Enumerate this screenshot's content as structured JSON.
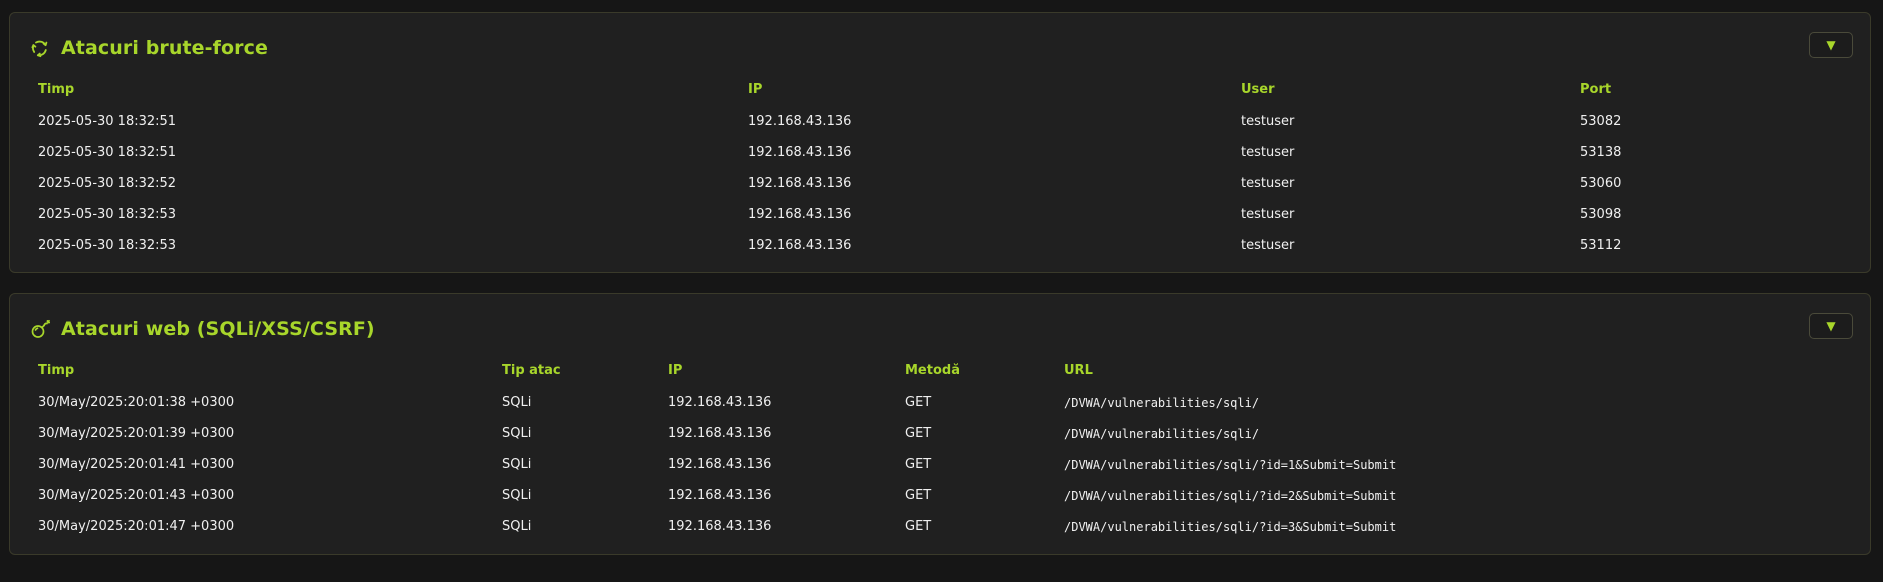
{
  "brute_force": {
    "icon": "recycle-icon",
    "title": "Atacuri brute-force",
    "toggle": "▼",
    "headers": [
      "Timp",
      "IP",
      "User",
      "Port"
    ],
    "rows": [
      [
        "2025-05-30 18:32:51",
        "192.168.43.136",
        "testuser",
        "53082"
      ],
      [
        "2025-05-30 18:32:51",
        "192.168.43.136",
        "testuser",
        "53138"
      ],
      [
        "2025-05-30 18:32:52",
        "192.168.43.136",
        "testuser",
        "53060"
      ],
      [
        "2025-05-30 18:32:53",
        "192.168.43.136",
        "testuser",
        "53098"
      ],
      [
        "2025-05-30 18:32:53",
        "192.168.43.136",
        "testuser",
        "53112"
      ]
    ]
  },
  "web": {
    "icon": "bomb-icon",
    "title": "Atacuri web (SQLi/XSS/CSRF)",
    "toggle": "▼",
    "headers": [
      "Timp",
      "Tip atac",
      "IP",
      "Metodă",
      "URL"
    ],
    "rows": [
      [
        "30/May/2025:20:01:38 +0300",
        "SQLi",
        "192.168.43.136",
        "GET",
        "/DVWA/vulnerabilities/sqli/"
      ],
      [
        "30/May/2025:20:01:39 +0300",
        "SQLi",
        "192.168.43.136",
        "GET",
        "/DVWA/vulnerabilities/sqli/"
      ],
      [
        "30/May/2025:20:01:41 +0300",
        "SQLi",
        "192.168.43.136",
        "GET",
        "/DVWA/vulnerabilities/sqli/?id=1&Submit=Submit"
      ],
      [
        "30/May/2025:20:01:43 +0300",
        "SQLi",
        "192.168.43.136",
        "GET",
        "/DVWA/vulnerabilities/sqli/?id=2&Submit=Submit"
      ],
      [
        "30/May/2025:20:01:47 +0300",
        "SQLi",
        "192.168.43.136",
        "GET",
        "/DVWA/vulnerabilities/sqli/?id=3&Submit=Submit"
      ]
    ]
  },
  "colors": {
    "accent": "#a8d62b",
    "panel_bg": "#202020",
    "page_bg": "#161616"
  }
}
